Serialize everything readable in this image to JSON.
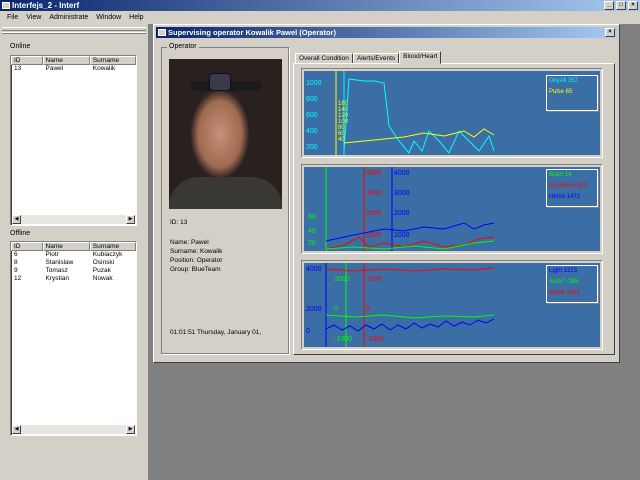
{
  "app": {
    "title": "Interfejs_2 - Interf"
  },
  "menu": [
    "File",
    "View",
    "Administrate",
    "Window",
    "Help"
  ],
  "online": {
    "label": "Online",
    "columns": [
      "ID",
      "Name",
      "Surname"
    ],
    "rows": [
      [
        "13",
        "Pawel",
        "Kowalik"
      ]
    ]
  },
  "offline": {
    "label": "Offline",
    "columns": [
      "ID",
      "Name",
      "Surname"
    ],
    "rows": [
      [
        "6",
        "Piotr",
        "Kubiaczyk"
      ],
      [
        "8",
        "Stanislaw",
        "Osinski"
      ],
      [
        "9",
        "Tomasz",
        "Puzak"
      ],
      [
        "12",
        "Krystian",
        "Nowak"
      ]
    ]
  },
  "child": {
    "title": "Supervising operator Kowalik Pawel (Operator)",
    "operator_label": "Operator",
    "id_line": "ID: 13",
    "name_line": "Name: Pawel",
    "surname_line": "Surname: Kowalik",
    "position_line": "Position: Operator",
    "group_line": "Group: BlueTeam",
    "time_line": "01:01:51  Thursday, January 01,",
    "tabs": [
      "Overall Condition",
      "Alerts/Events",
      "Blood/Heart"
    ],
    "active_tab": "Blood/Heart"
  },
  "graph1": {
    "axis1_ticks": [
      "1000",
      "800",
      "600",
      "400",
      "200"
    ],
    "axis2_ticks": [
      "160",
      "140",
      "120",
      "100",
      "80",
      "60",
      "40"
    ],
    "legend": [
      {
        "label": "OxyAll 357",
        "color": "#00ffff"
      },
      {
        "label": "Pulse 65",
        "color": "#ffff00"
      }
    ]
  },
  "graph2": {
    "axis1_ticks": [
      "4000",
      "3000",
      "2000",
      "1000"
    ],
    "axis2_ticks": [
      "4000",
      "3000",
      "2000",
      "1000"
    ],
    "axis3_ticks": [
      "60",
      "40",
      "20"
    ],
    "legend": [
      {
        "label": "Brain 14",
        "color": "#00ff00"
      },
      {
        "label": "OxyHemo 620",
        "color": "#ff0000"
      },
      {
        "label": "Hemo 1472",
        "color": "#0000ff"
      }
    ]
  },
  "graph3": {
    "axis1_ticks": [
      "4000",
      "2000",
      "0"
    ],
    "axis2_ticks": [
      "1000",
      "0",
      "-1000"
    ],
    "axis3_ticks": [
      "1000",
      "0",
      "-1000"
    ],
    "legend": [
      {
        "label": "Light 1323",
        "color": "#0000ff"
      },
      {
        "label": "Amb7 -385",
        "color": "#00ff00"
      },
      {
        "label": "Amb8 1481",
        "color": "#ff0000"
      }
    ]
  },
  "colors": {
    "plot_bg": "#3a6ea5",
    "titlebar": "#0a246a"
  }
}
